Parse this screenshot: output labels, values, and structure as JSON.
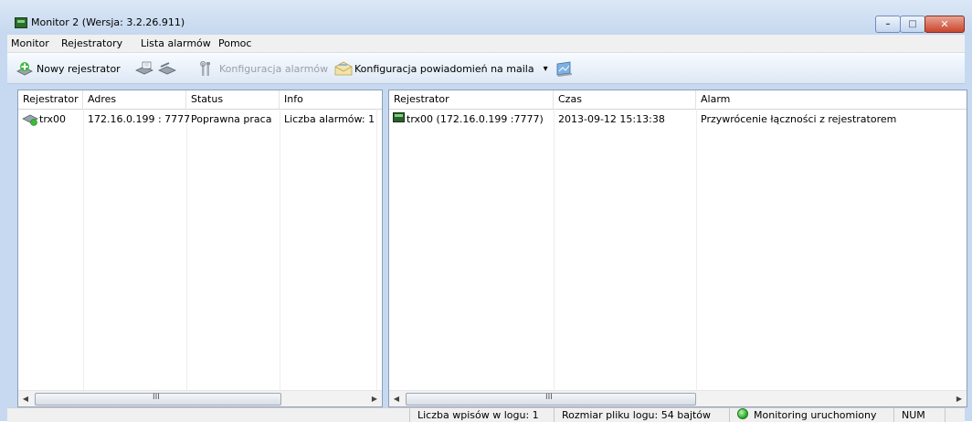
{
  "window": {
    "title": "Monitor 2 (Wersja: 3.2.26.911)",
    "controls": {
      "minimize": "–",
      "maximize": "□",
      "close": "✕"
    }
  },
  "menu": [
    {
      "label": "Monitor"
    },
    {
      "label": "Rejestratory"
    },
    {
      "label": "Lista alarmów"
    },
    {
      "label": "Pomoc"
    }
  ],
  "toolbar": {
    "new_recorder": "Nowy rejestrator",
    "alarm_config": "Konfiguracja alarmów",
    "email_config": "Konfiguracja powiadomień na maila",
    "dropdown_glyph": "▾"
  },
  "left_table": {
    "headers": [
      "Rejestrator",
      "Adres",
      "Status",
      "Info"
    ],
    "rows": [
      {
        "name": "trx00",
        "address": "172.16.0.199 : 7777",
        "status": "Poprawna praca",
        "info": "Liczba alarmów: 1"
      }
    ],
    "scroll_grip": "III"
  },
  "right_table": {
    "headers": [
      "Rejestrator",
      "Czas",
      "Alarm"
    ],
    "rows": [
      {
        "recorder": "trx00 (172.16.0.199 :7777)",
        "time": "2013-09-12 15:13:38",
        "alarm": "Przywrócenie łączności z rejestratorem"
      }
    ],
    "scroll_grip": "III"
  },
  "statusbar": {
    "log_entries": "Liczba wpisów w logu: 1",
    "log_size": "Rozmiar pliku logu: 54 bajtów",
    "monitoring": "Monitoring uruchomiony",
    "num": "NUM"
  },
  "colors": {
    "accent": "#26a326",
    "frame": "#c6d9f1",
    "close": "#c9452c"
  }
}
